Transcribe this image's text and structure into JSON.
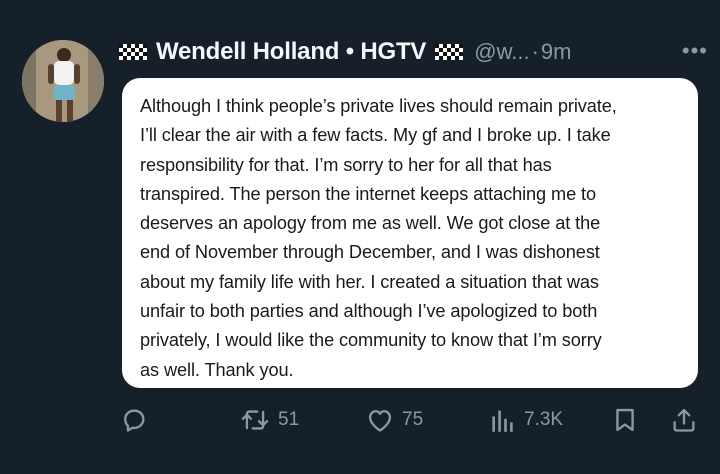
{
  "tweet": {
    "author_name": "Wendell Holland • HGTV",
    "handle": "@w...",
    "separator": "·",
    "time": "9m",
    "more_label": "•••",
    "text": "Although I think people’s private lives should remain private,\nI’ll clear the air with a few facts. My gf and I broke up. I take\nresponsibility for that. I’m sorry to her for all that has\ntranspired. The person the internet keeps attaching me to\ndeserves an apology from me as well. We got close at the\nend of November through December, and I was dishonest\nabout my family life with her. I created a situation that was\nunfair to both parties and although I’ve apologized to both\nprivately, I would like the community to know that I’m sorry\nas well.  Thank you."
  },
  "actions": {
    "reply_count": "",
    "retweet_count": "51",
    "like_count": "75",
    "views_count": "7.3K"
  },
  "icons": {
    "flag_left": "checkered-flag-icon",
    "flag_right": "checkered-flag-icon",
    "reply": "reply-icon",
    "retweet": "retweet-icon",
    "like": "heart-icon",
    "views": "views-bar-icon",
    "bookmark": "bookmark-icon",
    "share": "share-icon"
  },
  "colors": {
    "background": "#15202b",
    "secondary_text": "#8b98a5",
    "card_background": "#ffffff"
  }
}
